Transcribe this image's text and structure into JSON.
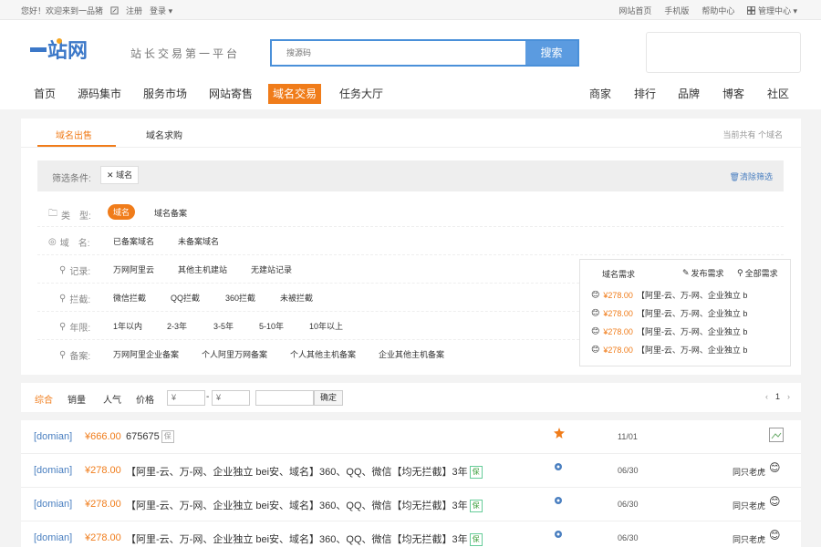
{
  "topbar": {
    "welcome": "您好！欢迎来到一品猪",
    "register": "注册",
    "login": "登录",
    "links": [
      "网站首页",
      "手机版",
      "帮助中心"
    ],
    "admin": "管理中心"
  },
  "header": {
    "logo_text": "一站网",
    "slogan": "站长交易第一平台",
    "search_placeholder": "搜源码",
    "search_button": "搜索"
  },
  "nav": {
    "left": [
      "首页",
      "源码集市",
      "服务市场",
      "网站寄售",
      "域名交易",
      "任务大厅"
    ],
    "right": [
      "商家",
      "排行",
      "品牌",
      "博客",
      "社区"
    ],
    "active": "域名交易"
  },
  "tabs": {
    "items": [
      "域名出售",
      "域名求购"
    ],
    "count_text": "当前共有  个域名"
  },
  "filter": {
    "label": "筛选条件:",
    "chip": "域名",
    "clear": "清除筛选"
  },
  "filter_rows": [
    {
      "key": "类　型:",
      "options": [
        "域名",
        "域名备案"
      ]
    },
    {
      "key": "域　名:",
      "options": [
        "已备案域名",
        "未备案域名"
      ]
    },
    {
      "key": "记录:",
      "options": [
        "万网阿里云",
        "其他主机建站",
        "无建站记录"
      ]
    },
    {
      "key": "拦截:",
      "options": [
        "微信拦截",
        "QQ拦截",
        "360拦截",
        "未被拦截"
      ]
    },
    {
      "key": "年限:",
      "options": [
        "1年以内",
        "2-3年",
        "3-5年",
        "5-10年",
        "10年以上"
      ]
    },
    {
      "key": "备案:",
      "options": [
        "万网阿里企业备案",
        "个人阿里万网备案",
        "个人其他主机备案",
        "企业其他主机备案"
      ]
    }
  ],
  "demand": {
    "title": "域名需求",
    "publish": "发布需求",
    "all": "全部需求",
    "items": [
      {
        "price": "¥278.00",
        "text": "【阿里-云、万-网、企业独立 b"
      },
      {
        "price": "¥278.00",
        "text": "【阿里-云、万-网、企业独立 b"
      },
      {
        "price": "¥278.00",
        "text": "【阿里-云、万-网、企业独立 b"
      },
      {
        "price": "¥278.00",
        "text": "【阿里-云、万-网、企业独立 b"
      }
    ]
  },
  "sortbar": {
    "items": [
      "综合",
      "销量",
      "人气",
      "价格"
    ],
    "min_placeholder": "¥",
    "max_placeholder": "¥",
    "dash": "-",
    "ok": "确定",
    "page": "1"
  },
  "listings": [
    {
      "category": "[domian]",
      "price": "¥666.00",
      "title": "675675",
      "badge": "保",
      "date": "11/01",
      "seller": ""
    },
    {
      "category": "[domian]",
      "price": "¥278.00",
      "title": "【阿里-云、万-网、企业独立 bei安、域名】360、QQ、微信【均无拦截】3年",
      "badge": "保",
      "date": "06/30",
      "seller": "同只老虎"
    },
    {
      "category": "[domian]",
      "price": "¥278.00",
      "title": "【阿里-云、万-网、企业独立 bei安、域名】360、QQ、微信【均无拦截】3年",
      "badge": "保",
      "date": "06/30",
      "seller": "同只老虎"
    },
    {
      "category": "[domian]",
      "price": "¥278.00",
      "title": "【阿里-云、万-网、企业独立 bei安、域名】360、QQ、微信【均无拦截】3年",
      "badge": "保",
      "date": "06/30",
      "seller": "同只老虎"
    }
  ],
  "colors": {
    "accent": "#f07c1a",
    "link": "#4a7fc0",
    "search_border": "#4a90d9"
  }
}
